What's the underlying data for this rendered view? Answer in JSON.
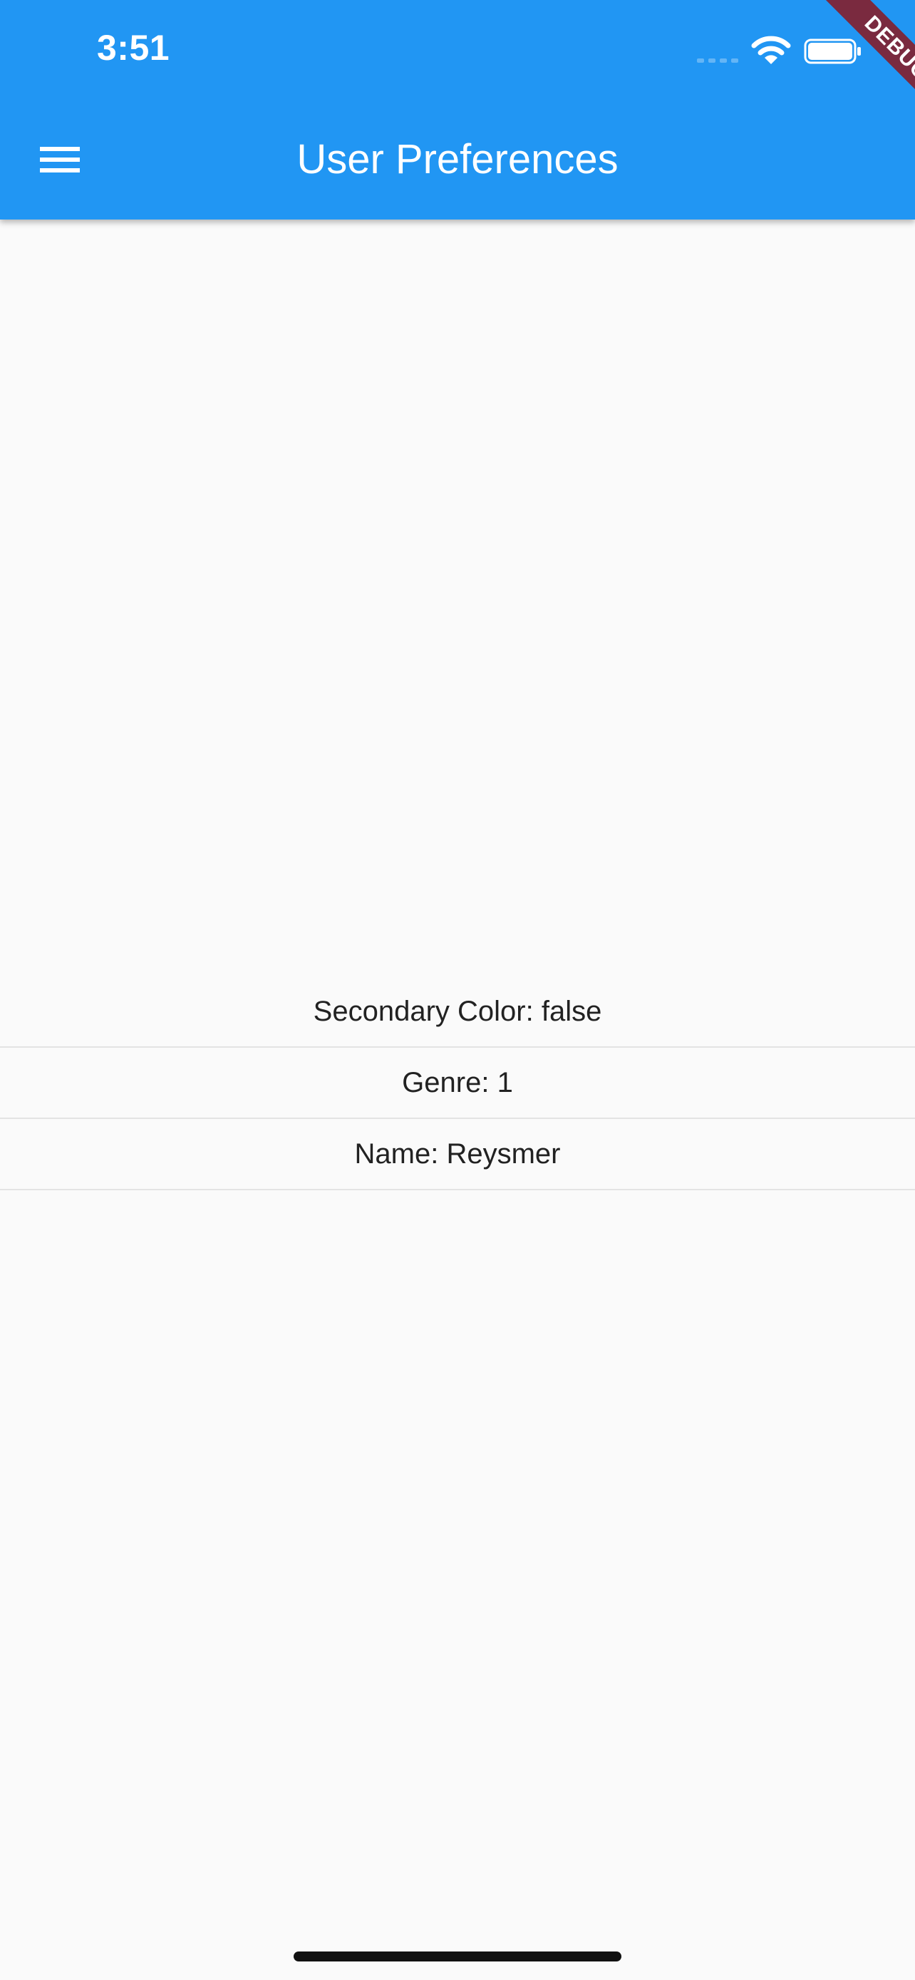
{
  "status_bar": {
    "time": "3:51"
  },
  "app_bar": {
    "title": "User Preferences",
    "menu_icon": "menu-icon",
    "color": "#2196f3"
  },
  "debug_banner": {
    "label": "DEBUG"
  },
  "preferences": [
    {
      "text": "Secondary Color: false"
    },
    {
      "text": "Genre: 1"
    },
    {
      "text": "Name: Reysmer"
    }
  ]
}
